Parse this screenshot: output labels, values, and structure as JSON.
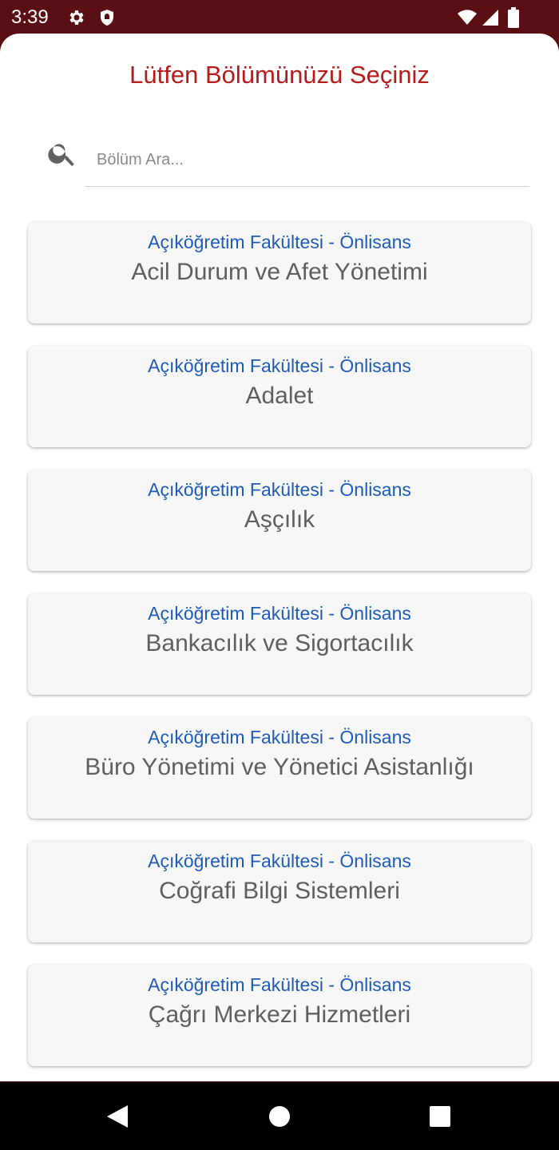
{
  "status_bar": {
    "time": "3:39",
    "icons": [
      "gear-icon",
      "shield-icon",
      "wifi-icon",
      "signal-icon",
      "battery-icon"
    ]
  },
  "sheet": {
    "title": "Lütfen Bölümünüzü Seçiniz",
    "title_color": "#b71c1c"
  },
  "search": {
    "placeholder": "Bölüm Ara...",
    "value": ""
  },
  "departments": [
    {
      "faculty": "Açıköğretim Fakültesi - Önlisans",
      "name": "Acil Durum ve Afet Yönetimi"
    },
    {
      "faculty": "Açıköğretim Fakültesi - Önlisans",
      "name": "Adalet"
    },
    {
      "faculty": "Açıköğretim Fakültesi - Önlisans",
      "name": "Aşçılık"
    },
    {
      "faculty": "Açıköğretim Fakültesi - Önlisans",
      "name": "Bankacılık ve Sigortacılık"
    },
    {
      "faculty": "Açıköğretim Fakültesi - Önlisans",
      "name": "Büro Yönetimi ve Yönetici Asistanlığı"
    },
    {
      "faculty": "Açıköğretim Fakültesi - Önlisans",
      "name": "Coğrafi Bilgi Sistemleri"
    },
    {
      "faculty": "Açıköğretim Fakültesi - Önlisans",
      "name": "Çağrı Merkezi Hizmetleri"
    }
  ],
  "colors": {
    "status_bar": "#5a0f14",
    "faculty_text": "#1e5bb8",
    "department_text": "#5f5f5f",
    "card_background": "#f7f7f7"
  },
  "nav_bar": {
    "icons": [
      "back-icon",
      "home-icon",
      "recent-apps-icon"
    ]
  }
}
